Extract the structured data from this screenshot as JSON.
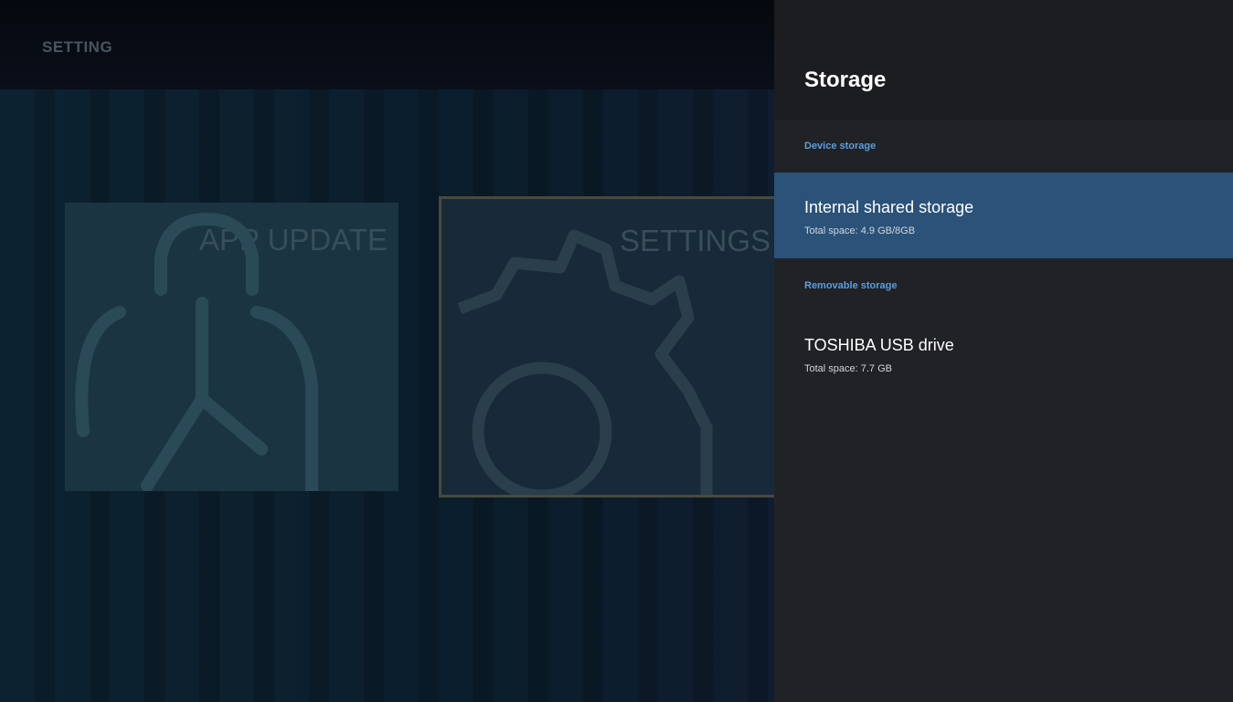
{
  "screen": {
    "title": "SETTING"
  },
  "tiles": [
    {
      "label": "APP UPDATE",
      "icon": "shopping-bag-upload-icon"
    },
    {
      "label": "SETTINGS",
      "icon": "gear-icon"
    }
  ],
  "panel": {
    "title": "Storage",
    "sections": [
      {
        "label": "Device storage",
        "items": [
          {
            "title": "Internal shared storage",
            "subtitle": "Total space: 4.9 GB/8GB",
            "selected": true
          }
        ]
      },
      {
        "label": "Removable storage",
        "items": [
          {
            "title": "TOSHIBA USB drive",
            "subtitle": "Total space: 7.7 GB",
            "selected": false
          }
        ]
      }
    ]
  },
  "colors": {
    "accent_blue": "#5a9ee0",
    "selected_bg": "#2b5278",
    "panel_bg": "#212225"
  }
}
